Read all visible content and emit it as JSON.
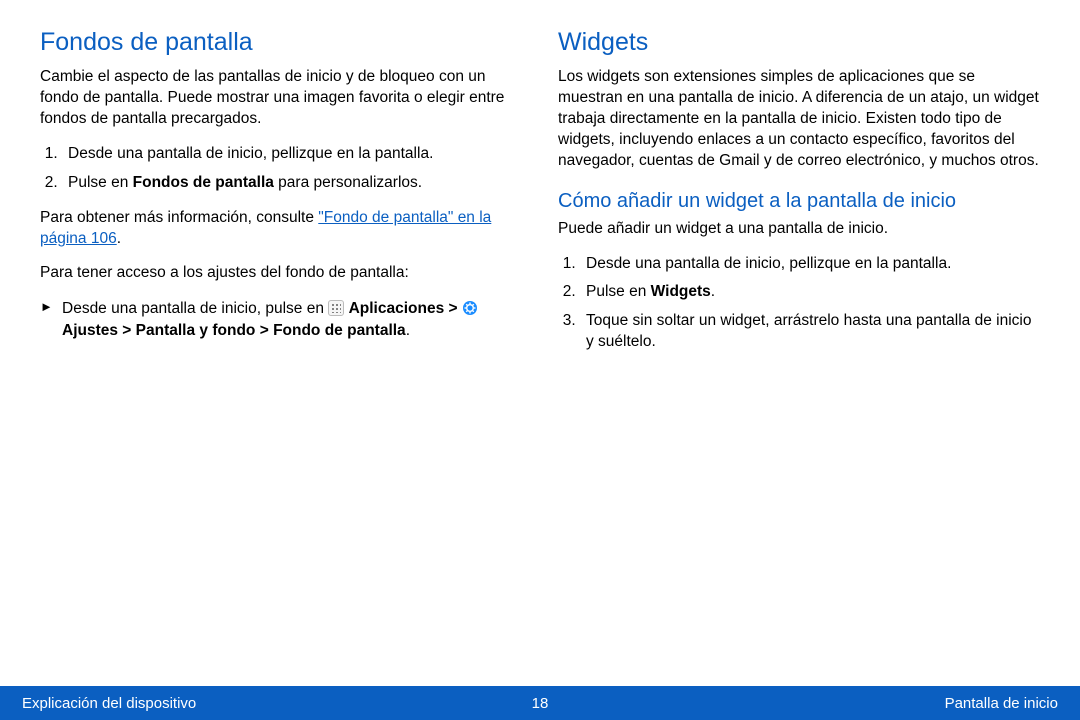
{
  "left": {
    "heading": "Fondos de pantalla",
    "intro": "Cambie el aspecto de las pantallas de inicio y de bloqueo con un fondo de pantalla. Puede mostrar una imagen favorita o elegir entre fondos de pantalla precargados.",
    "step1": "Desde una pantalla de inicio, pellizque en la pantalla.",
    "step2_pre": "Pulse en ",
    "step2_bold": "Fondos de pantalla",
    "step2_post": " para personalizarlos.",
    "moreinfo_pre": "Para obtener más información, consulte ",
    "moreinfo_link": "\"Fondo de pantalla\" en la página 106",
    "moreinfo_post": ".",
    "access": "Para tener acceso a los ajustes del fondo de pantalla:",
    "bullet_pre": "Desde una pantalla de inicio, pulse en ",
    "bullet_apps": "Aplicaciones",
    "bullet_sep1": " > ",
    "bullet_settings": " Ajustes",
    "bullet_sep2": " > ",
    "bullet_screen": "Pantalla y fondo",
    "bullet_sep3": " > ",
    "bullet_wall": "Fondo de pantalla",
    "bullet_end": "."
  },
  "right": {
    "heading": "Widgets",
    "intro": "Los widgets son extensiones simples de aplicaciones que se muestran en una pantalla de inicio. A diferencia de un atajo, un widget trabaja directamente en la pantalla de inicio. Existen todo tipo de widgets, incluyendo enlaces a un contacto específico, favoritos del navegador, cuentas de Gmail y de correo electrónico, y muchos otros.",
    "sub": "Cómo añadir un widget a la pantalla de inicio",
    "subp": "Puede añadir un widget a una pantalla de inicio.",
    "step1": "Desde una pantalla de inicio, pellizque en la pantalla.",
    "step2_pre": "Pulse en ",
    "step2_bold": "Widgets",
    "step2_post": ".",
    "step3": "Toque sin soltar un widget, arrástrelo hasta una pantalla de inicio y suéltelo."
  },
  "footer": {
    "left": "Explicación del dispositivo",
    "page": "18",
    "right": "Pantalla de inicio"
  }
}
